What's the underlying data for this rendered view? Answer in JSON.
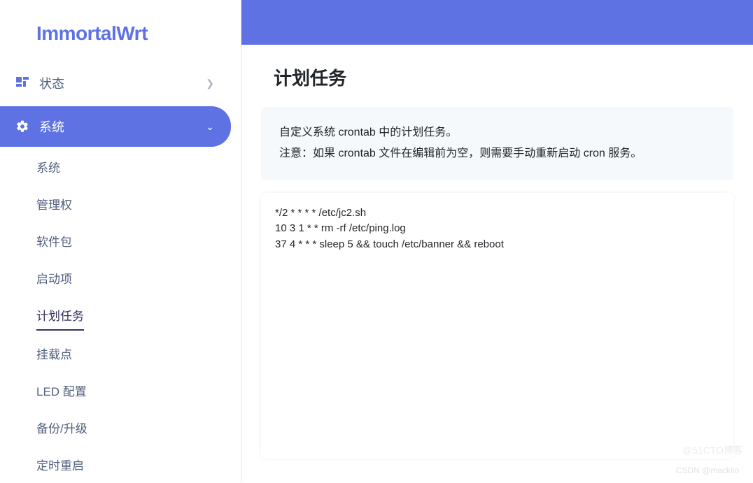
{
  "brand": "ImmortalWrt",
  "nav": {
    "status": {
      "label": "状态"
    },
    "system": {
      "label": "系统"
    },
    "sub": {
      "system": "系统",
      "admin": "管理权",
      "software": "软件包",
      "startup": "启动项",
      "cron": "计划任务",
      "mounts": "挂载点",
      "led": "LED 配置",
      "backup": "备份/升级",
      "reboot": "定时重启"
    }
  },
  "page": {
    "title": "计划任务",
    "desc_line1": "自定义系统 crontab 中的计划任务。",
    "desc_line2": "注意：如果 crontab 文件在编辑前为空，则需要手动重新启动 cron 服务。",
    "crontab": "*/2 * * * * /etc/jc2.sh\n10 3 1 * * rm -rf /etc/ping.log\n37 4 * * * sleep 5 && touch /etc/banner && reboot"
  },
  "watermark1": "CSDN @mackilo",
  "watermark2": "@51CTO博客"
}
